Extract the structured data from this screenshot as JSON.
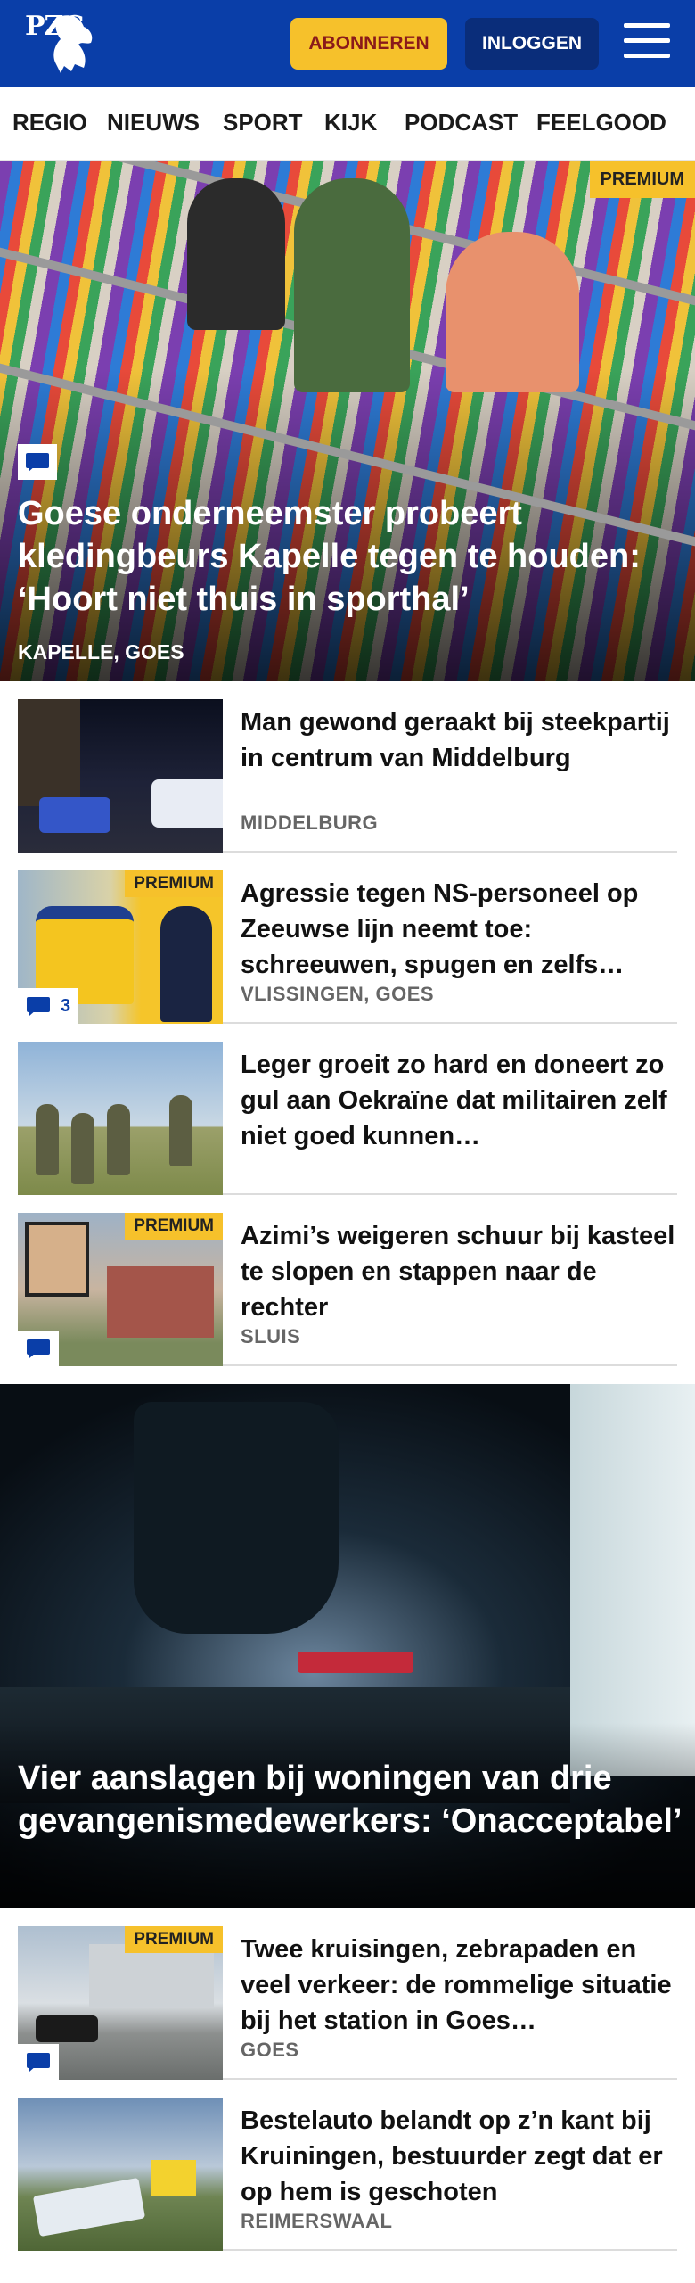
{
  "header": {
    "logo_text": "PZC",
    "subscribe_label": "ABONNEREN",
    "login_label": "INLOGGEN",
    "brand_color": "#0a3ea8",
    "accent_color": "#f6c12b"
  },
  "nav": {
    "items": [
      "REGIO",
      "NIEUWS",
      "SPORT",
      "KIJK",
      "PODCAST",
      "FEELGOOD"
    ]
  },
  "hero": {
    "badge": "PREMIUM",
    "title": "Goese onderneemster probeert kledingbeurs Kapelle tegen te houden: ‘Hoort niet thuis in sporthal’",
    "location": "KAPELLE, GOES"
  },
  "articles": [
    {
      "title": "Man gewond geraakt bij steekpartij in centrum van Middelburg",
      "location": "MIDDELBURG"
    },
    {
      "badge": "PREMIUM",
      "comments": "3",
      "title": "Agressie tegen NS-personeel op Zeeuwse lijn neemt toe: schreeuwen, spugen en zelfs…",
      "location": "VLISSINGEN, GOES"
    },
    {
      "title": "Leger groeit zo hard en doneert zo gul aan Oekraïne dat militairen zelf niet goed kunnen…"
    },
    {
      "badge": "PREMIUM",
      "title": "Azimi’s weigeren schuur bij kasteel te slopen en stappen naar de rechter",
      "location": "SLUIS"
    }
  ],
  "feature": {
    "title": "Vier aanslagen bij woningen van drie gevangenismedewerkers: ‘Onacceptabel’"
  },
  "articles2": [
    {
      "badge": "PREMIUM",
      "title": "Twee kruisingen, zebrapaden en veel verkeer: de rommelige situatie bij het station in Goes…",
      "location": "GOES"
    },
    {
      "title": "Bestelauto belandt op z’n kant bij Kruiningen, bestuurder zegt dat er op hem is geschoten",
      "location": "REIMERSWAAL"
    }
  ]
}
